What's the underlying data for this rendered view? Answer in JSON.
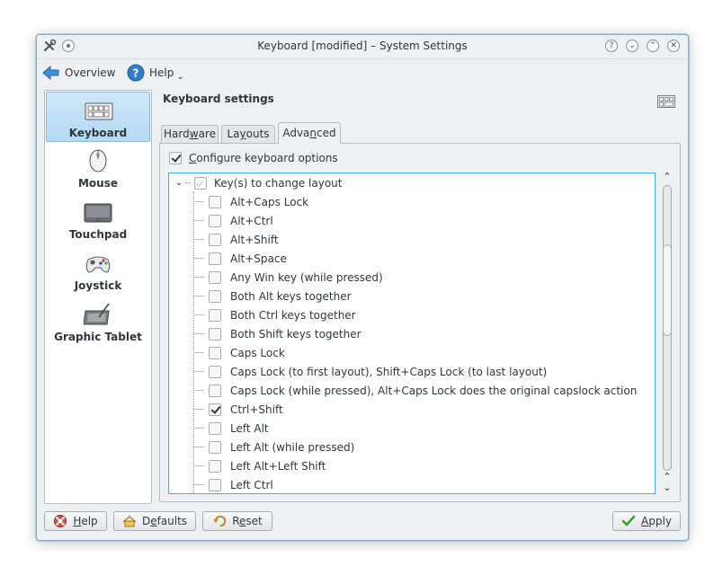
{
  "window": {
    "title": "Keyboard [modified] – System Settings",
    "title_buttons": [
      "?",
      "⌄",
      "⌃",
      "✕"
    ]
  },
  "toolbar": {
    "overview_label": "Overview",
    "help_label": "Help",
    "help_arrow": "⌄"
  },
  "sidebar": {
    "items": [
      {
        "label": "Keyboard",
        "icon": "keyboard-icon",
        "selected": true
      },
      {
        "label": "Mouse",
        "icon": "mouse-icon",
        "selected": false
      },
      {
        "label": "Touchpad",
        "icon": "touchpad-icon",
        "selected": false
      },
      {
        "label": "Joystick",
        "icon": "joystick-icon",
        "selected": false
      },
      {
        "label": "Graphic Tablet",
        "icon": "tablet-icon",
        "selected": false
      }
    ]
  },
  "main": {
    "title": "Keyboard settings",
    "tabs": [
      {
        "pre": "Hard",
        "mn": "w",
        "post": "are",
        "active": false
      },
      {
        "pre": "La",
        "mn": "y",
        "post": "outs",
        "active": false
      },
      {
        "pre": "Adva",
        "mn": "n",
        "post": "ced",
        "active": true
      }
    ],
    "configure": {
      "mn": "C",
      "rest": "onfigure keyboard options",
      "checked": true
    },
    "tree": {
      "group_label": "Key(s) to change layout",
      "group_expand": "⌄",
      "items": [
        {
          "label": "Alt+Caps Lock",
          "checked": false
        },
        {
          "label": "Alt+Ctrl",
          "checked": false
        },
        {
          "label": "Alt+Shift",
          "checked": false
        },
        {
          "label": "Alt+Space",
          "checked": false
        },
        {
          "label": "Any Win key (while pressed)",
          "checked": false
        },
        {
          "label": "Both Alt keys together",
          "checked": false
        },
        {
          "label": "Both Ctrl keys together",
          "checked": false
        },
        {
          "label": "Both Shift keys together",
          "checked": false
        },
        {
          "label": "Caps Lock",
          "checked": false
        },
        {
          "label": "Caps Lock (to first layout), Shift+Caps Lock (to last layout)",
          "checked": false
        },
        {
          "label": "Caps Lock (while pressed), Alt+Caps Lock does the original capslock action",
          "checked": false
        },
        {
          "label": "Ctrl+Shift",
          "checked": true
        },
        {
          "label": "Left Alt",
          "checked": false
        },
        {
          "label": "Left Alt (while pressed)",
          "checked": false
        },
        {
          "label": "Left Alt+Left Shift",
          "checked": false
        },
        {
          "label": "Left Ctrl",
          "checked": false
        }
      ]
    },
    "scroll": {
      "up": "⌃",
      "down_up": "⌃",
      "down": "⌄"
    }
  },
  "buttons": {
    "help": {
      "mn": "H",
      "rest": "elp"
    },
    "defaults": {
      "pre": "D",
      "mn": "e",
      "post": "faults"
    },
    "reset": {
      "pre": "R",
      "mn": "e",
      "post": "set"
    },
    "apply": {
      "mn": "A",
      "rest": "pply"
    }
  },
  "colors": {
    "accent": "#3daee9",
    "selection": "#b4daf4",
    "apply_check": "#3c9a2e"
  }
}
